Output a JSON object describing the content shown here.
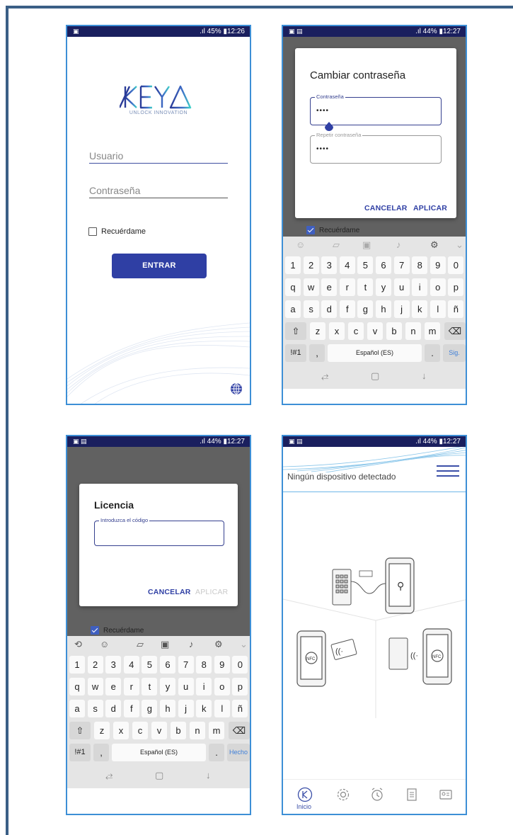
{
  "colors": {
    "statusbar": "#1a1f5e",
    "primary": "#2f3fa4",
    "phone_border": "#3d8fd6",
    "frame": "#3a5f86",
    "scrim": "#616161"
  },
  "login": {
    "status": {
      "left_icon": "image-icon",
      "right": ".ıl 45% ▮12:26"
    },
    "logo_sub": "UNLOCK INNOVATION",
    "username_placeholder": "Usuario",
    "password_placeholder": "Contraseña",
    "remember_label": "Recuérdame",
    "enter_label": "ENTRAR",
    "globe_icon": "globe-icon"
  },
  "change_password": {
    "status": {
      "left": "▣ ▤",
      "right": ".ıl 44% ▮12:27"
    },
    "title": "Cambiar contraseña",
    "field1_label": "Contraseña",
    "field1_value": "••••",
    "field2_label": "Repetir contraseña",
    "field2_value": "••••",
    "cancel_label": "CANCELAR",
    "apply_label": "APLICAR",
    "remember_label": "Recuérdame",
    "keyboard": {
      "row_numbers": [
        "1",
        "2",
        "3",
        "4",
        "5",
        "6",
        "7",
        "8",
        "9",
        "0"
      ],
      "row_q": [
        "q",
        "w",
        "e",
        "r",
        "t",
        "y",
        "u",
        "i",
        "o",
        "p"
      ],
      "row_a": [
        "a",
        "s",
        "d",
        "f",
        "g",
        "h",
        "j",
        "k",
        "l",
        "ñ"
      ],
      "row_z": [
        "z",
        "x",
        "c",
        "v",
        "b",
        "n",
        "m"
      ],
      "sym_label": "!#1",
      "comma": ",",
      "space_label": "Español (ES)",
      "period": ".",
      "action_label": "Sig."
    }
  },
  "license": {
    "status": {
      "left": "▣ ▤",
      "right": ".ıl 44% ▮12:27"
    },
    "title": "Licencia",
    "code_label": "Introduzca el código",
    "cancel_label": "CANCELAR",
    "apply_label": "APLICAR",
    "remember_label": "Recuérdame",
    "keyboard": {
      "row_numbers": [
        "1",
        "2",
        "3",
        "4",
        "5",
        "6",
        "7",
        "8",
        "9",
        "0"
      ],
      "row_q": [
        "q",
        "w",
        "e",
        "r",
        "t",
        "y",
        "u",
        "i",
        "o",
        "p"
      ],
      "row_a": [
        "a",
        "s",
        "d",
        "f",
        "g",
        "h",
        "j",
        "k",
        "l",
        "ñ"
      ],
      "row_z": [
        "z",
        "x",
        "c",
        "v",
        "b",
        "n",
        "m"
      ],
      "sym_label": "!#1",
      "comma": ",",
      "space_label": "Español (ES)",
      "period": ".",
      "action_label": "Hecho"
    }
  },
  "home": {
    "status": {
      "left": "▣ ▤",
      "right": ".ıl 44% ▮12:27"
    },
    "title": "Ningún dispositivo detectado",
    "nfc_label_left": "NFC",
    "nfc_label_right": "NFC",
    "tabs": [
      {
        "label": "Inicio",
        "icon": "home-logo-icon"
      },
      {
        "icon": "gear-icon"
      },
      {
        "icon": "alarm-icon"
      },
      {
        "icon": "list-icon"
      },
      {
        "icon": "id-card-icon"
      }
    ]
  }
}
